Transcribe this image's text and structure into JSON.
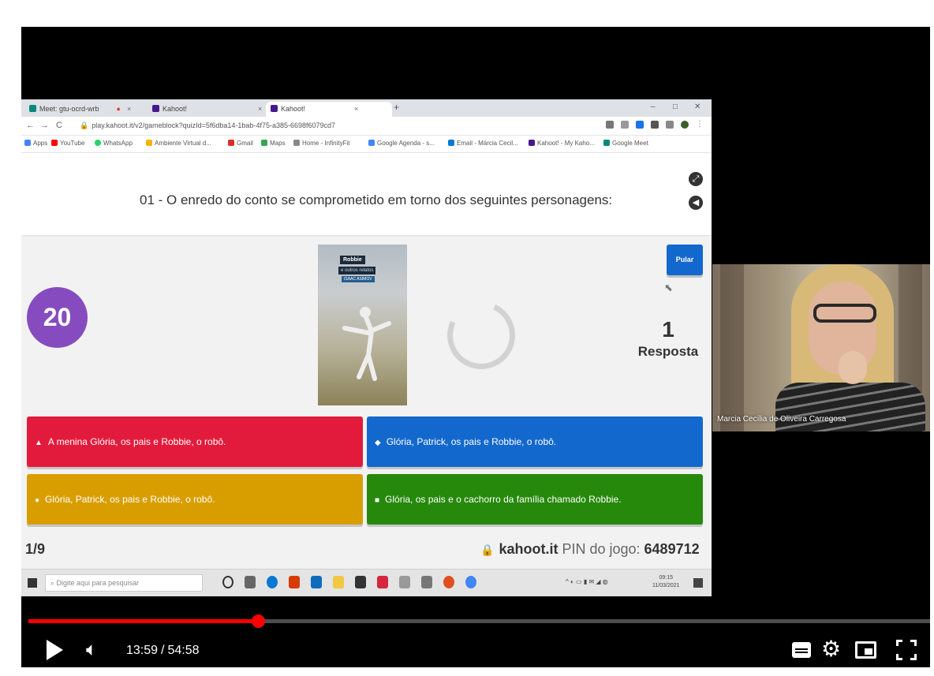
{
  "browser": {
    "tabs": [
      {
        "label": "Meet: gtu-ocrd-wrb",
        "color": "#00897b"
      },
      {
        "label": "Kahoot!",
        "color": "#46178f"
      },
      {
        "label": "Kahoot!",
        "color": "#46178f"
      }
    ],
    "url": "play.kahoot.it/v2/gameblock?quizId=5f6dba14-1bab-4f75-a385-6698f6079cd7",
    "bookmarks": [
      {
        "label": "Apps",
        "color": "#4285f4"
      },
      {
        "label": "YouTube",
        "color": "#ff0000"
      },
      {
        "label": "WhatsApp",
        "color": "#25d366"
      },
      {
        "label": "Ambiente Virtual d...",
        "color": "#f4b400"
      },
      {
        "label": "Gmail",
        "color": "#d93025"
      },
      {
        "label": "Maps",
        "color": "#34a853"
      },
      {
        "label": "Home - InfinityFit",
        "color": "#888888"
      },
      {
        "label": "Google Agenda - s...",
        "color": "#4285f4"
      },
      {
        "label": "Email - Márcia Cecil...",
        "color": "#0078d4"
      },
      {
        "label": "Kahoot! - My Kaho...",
        "color": "#46178f"
      },
      {
        "label": "Google Meet",
        "color": "#00897b"
      }
    ]
  },
  "kahoot": {
    "question": "01 - O enredo do conto se comprometido em torno dos seguintes personagens:",
    "timer": "20",
    "skip_label": "Pular",
    "answer_count": "1",
    "answer_label": "Resposta",
    "cover_title": "Robbie",
    "cover_subtitle": "e outros relatos",
    "cover_author": "ISAAC ASIMOV",
    "answers": [
      {
        "shape": "▲",
        "text": "A menina Glória, os pais e Robbie, o robô.",
        "color": "#e21b3c"
      },
      {
        "shape": "◆",
        "text": "Glória, Patrick, os pais e Robbie, o robô.",
        "color": "#1368ce"
      },
      {
        "shape": "●",
        "text": "Glória, Patrick, os pais e Robbie, o robô.",
        "color": "#d89e00"
      },
      {
        "shape": "■",
        "text": "Glória, os pais e o cachorro da família chamado Robbie.",
        "color": "#26890c"
      }
    ],
    "progress": "1/9",
    "site": "kahoot.it",
    "pin_label": "PIN do jogo:",
    "pin": "6489712"
  },
  "taskbar": {
    "search_placeholder": "Digite aqui para pesquisar",
    "time": "09:15",
    "date": "11/03/2021"
  },
  "webcam": {
    "participant_name": "Marcia Cecília de Oliveira Carregosa"
  },
  "player": {
    "current_time": "13:59",
    "separator": "/",
    "duration": "54:58",
    "progress_fraction": 0.2547,
    "accent": "#ff0000",
    "icons": [
      "play-icon",
      "volume-icon",
      "subtitles-icon",
      "gear-icon",
      "miniplayer-icon",
      "fullscreen-icon"
    ]
  }
}
